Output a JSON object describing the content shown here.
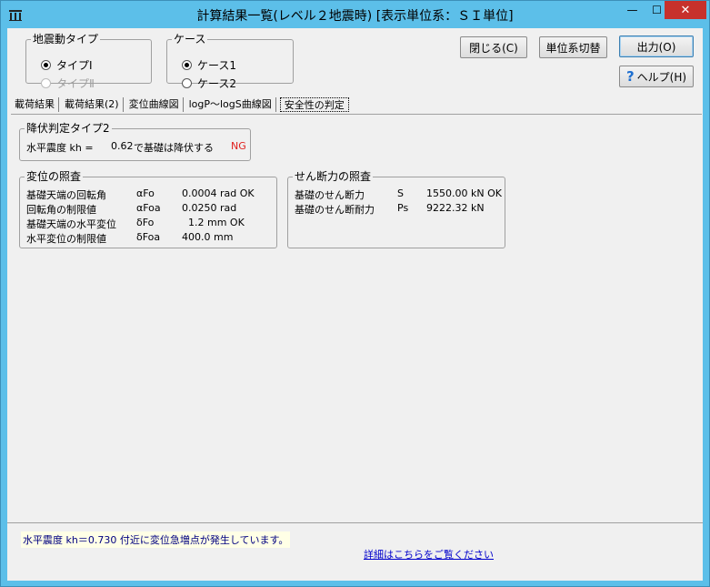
{
  "window": {
    "title": "計算結果一覧(レベル２地震時) [表示単位系：ＳＩ単位]",
    "min_glyph": "—",
    "max_glyph": "☐",
    "close_glyph": "✕"
  },
  "ground_motion": {
    "legend": "地震動タイプ",
    "options": [
      "タイプⅠ",
      "タイプⅡ"
    ],
    "selected": "タイプⅠ"
  },
  "case": {
    "legend": "ケース",
    "options": [
      "ケース1",
      "ケース2"
    ],
    "selected": "ケース1"
  },
  "buttons": {
    "close": "閉じる(C)",
    "unit_switch": "単位系切替",
    "output": "出力(O)",
    "help": "ヘルプ(H)"
  },
  "tabs": [
    "載荷結果",
    "載荷結果(2)",
    "変位曲線図",
    "logP～logS曲線図",
    "安全性の判定"
  ],
  "active_tab": "安全性の判定",
  "yield": {
    "legend": "降伏判定タイプ2",
    "label": "水平震度 kh =",
    "value": "0.62",
    "text": "で基礎は降伏する",
    "result": "NG"
  },
  "displacement": {
    "legend": "変位の照査",
    "rows": [
      {
        "label": "基礎天端の回転角",
        "symbol": "αFo",
        "value": "0.0004 rad OK"
      },
      {
        "label": "回転角の制限値",
        "symbol": "αFoa",
        "value": "0.0250 rad"
      },
      {
        "label": "基礎天端の水平変位",
        "symbol": "δFo",
        "value": "  1.2 mm OK"
      },
      {
        "label": "水平変位の制限値",
        "symbol": "δFoa",
        "value": "400.0 mm"
      }
    ]
  },
  "shear": {
    "legend": "せん断力の照査",
    "rows": [
      {
        "label": "基礎のせん断力",
        "symbol": "S",
        "value": "1550.00 kN OK"
      },
      {
        "label": "基礎のせん断耐力",
        "symbol": "Ps",
        "value": "9222.32 kN"
      }
    ]
  },
  "status": {
    "message": "水平震度 kh＝0.730 付近に変位急増点が発生しています。",
    "link": "詳細はこちらをご覧ください"
  },
  "colors": {
    "titlebar": "#5cbfe9",
    "close_button": "#c7312c",
    "ng": "#e0201e",
    "link": "#0000cc",
    "status_text": "#000080"
  }
}
